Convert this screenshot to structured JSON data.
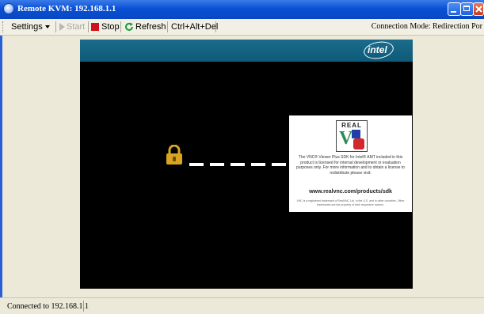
{
  "window": {
    "title": "Remote KVM: 192.168.1.1"
  },
  "toolbar": {
    "settings_label": "Settings",
    "start_label": "Start",
    "stop_label": "Stop",
    "refresh_label": "Refresh",
    "cad_label": "Ctrl+Alt+Del",
    "connection_mode": "Connection Mode: Redirection Por"
  },
  "remote_screen": {
    "brand_logo_text": "intel",
    "vnc_panel": {
      "logo_text": "REAL",
      "body": "The VNC® Viewer Plus SDK for Intel® AMT included in this product is licensed for internal development or evaluation purposes only. For more information and to obtain a license to redistribute please visit:",
      "url": "www.realvnc.com/products/sdk",
      "fine_print": "VNC is a registered trademark of RealVNC Ltd. in the U.S. and in other countries. Other trademarks are the property of their respective owners."
    }
  },
  "status_bar": {
    "text": "Connected to 192.168.1.1"
  },
  "colors": {
    "title_bar": "#0a51d6",
    "banner": "#1b6c8c",
    "stop_icon": "#d0121a",
    "lock_icon": "#d9a520"
  }
}
